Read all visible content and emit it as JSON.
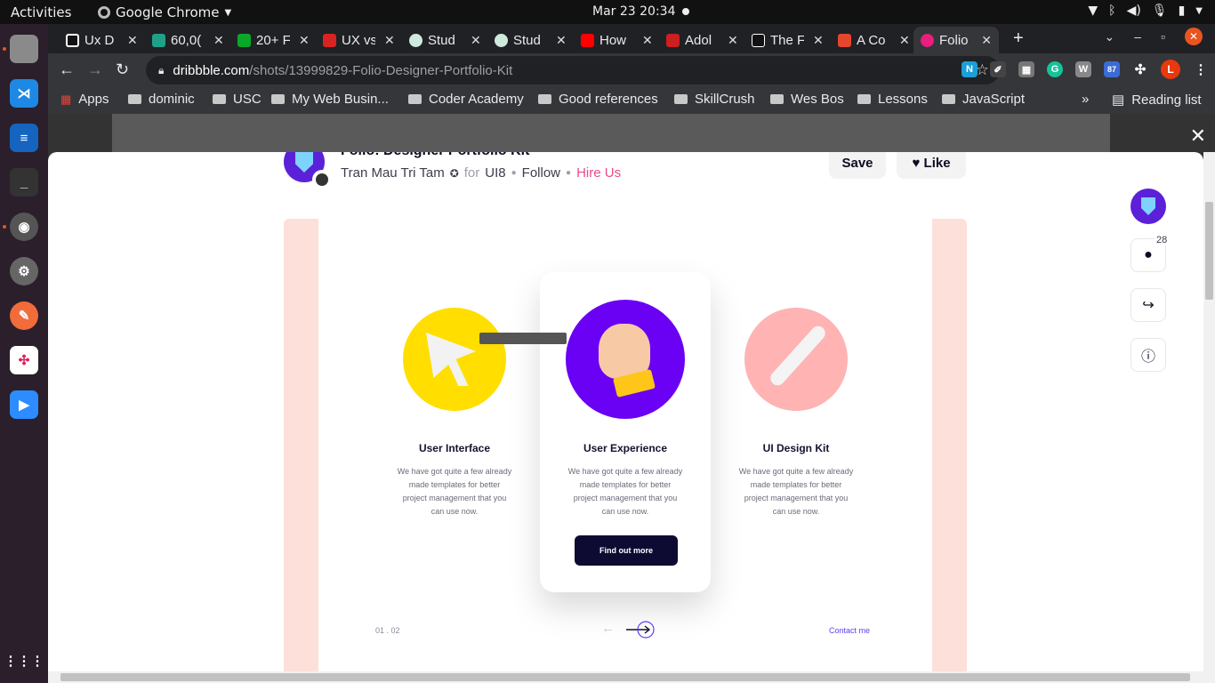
{
  "topbar": {
    "activities": "Activities",
    "app_name": "Google Chrome",
    "clock": "Mar 23  20:34"
  },
  "tabs": [
    {
      "label": "Ux D",
      "color": "#111111"
    },
    {
      "label": "60,0(",
      "color": "#21a089"
    },
    {
      "label": "20+ F",
      "color": "#09a82b"
    },
    {
      "label": "UX vs",
      "color": "#d92323"
    },
    {
      "label": "Stud",
      "color": "#cfe9dc"
    },
    {
      "label": "Stud",
      "color": "#cfe9dc"
    },
    {
      "label": "How",
      "color": "#ff0000"
    },
    {
      "label": "Adol",
      "color": "#cc1f1f"
    },
    {
      "label": "The F",
      "color": "#111111"
    },
    {
      "label": "A Co",
      "color": "#e6462d"
    },
    {
      "label": "Folio",
      "color": "#ea1e7c"
    }
  ],
  "address": {
    "domain": "dribbble.com",
    "path": "/shots/13999829-Folio-Designer-Portfolio-Kit"
  },
  "extensions": {
    "badge": "87",
    "profile": "L"
  },
  "bookmarks": {
    "apps": "Apps",
    "items": [
      "dominic",
      "USC",
      "My Web Busin...",
      "Coder Academy",
      "Good references",
      "SkillCrush",
      "Wes Bos",
      "Lessons",
      "JavaScript"
    ],
    "reading_list": "Reading list"
  },
  "shot": {
    "title": "Folio: Designer Portfolio Kit",
    "author": "Tran Mau Tri Tam",
    "pro": "✪",
    "for_word": "for",
    "team": "UI8",
    "follow": "Follow",
    "hire": "Hire Us",
    "save": "Save",
    "like": "Like",
    "comment_count": "28"
  },
  "design": {
    "columns": [
      {
        "title": "User Interface",
        "desc": "We have got quite a few already made templates for better project management that you can use now.",
        "color": "#ffde00"
      },
      {
        "title": "User Experience",
        "desc": "We have got quite a few already made templates for better project management that you can use now.",
        "color": "#6a00f4"
      },
      {
        "title": "UI Design Kit",
        "desc": "We have got quite a few already made templates for better project management that you can use now.",
        "color": "#ffb3b3"
      }
    ],
    "button": "Find out more",
    "pager": "01  .  02",
    "contact": "Contact me"
  }
}
